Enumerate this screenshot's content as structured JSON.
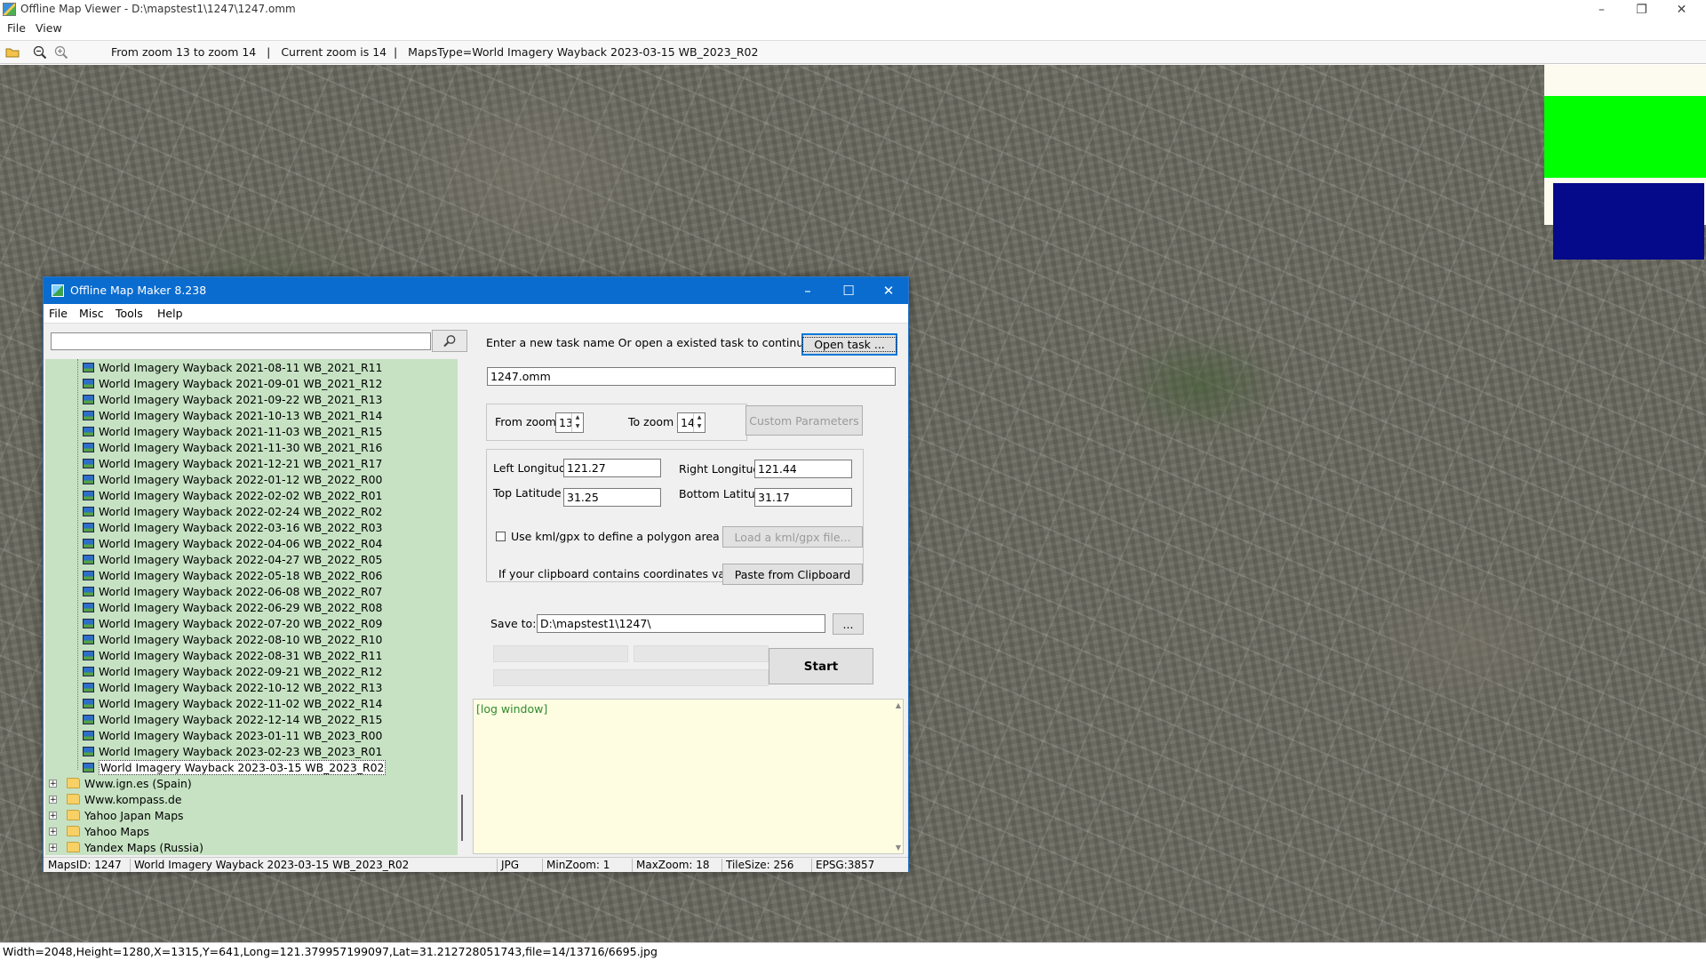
{
  "outer_window": {
    "title": "Offline Map Viewer - D:\\mapstest1\\1247\\1247.omm",
    "menu": [
      "File",
      "View"
    ],
    "toolbar_status": "From zoom 13 to zoom 14   |   Current zoom is 14  |   MapsType=World Imagery Wayback 2023-03-15 WB_2023_R02",
    "statusbar_text": "Width=2048,Height=1280,X=1315,Y=641,Long=121.379957199097,Lat=31.212728051743,file=14/13716/6695.jpg"
  },
  "overview": {
    "green_color": "#00ff00",
    "blue_color": "#050a8a"
  },
  "dialog": {
    "title": "Offline Map Maker 8.238",
    "menu": [
      "File",
      "Misc",
      "Tools",
      "Help"
    ],
    "search": {
      "value": "",
      "placeholder": ""
    },
    "tree_leaves": [
      "World Imagery Wayback 2021-08-11 WB_2021_R11",
      "World Imagery Wayback 2021-09-01 WB_2021_R12",
      "World Imagery Wayback 2021-09-22 WB_2021_R13",
      "World Imagery Wayback 2021-10-13 WB_2021_R14",
      "World Imagery Wayback 2021-11-03 WB_2021_R15",
      "World Imagery Wayback 2021-11-30 WB_2021_R16",
      "World Imagery Wayback 2021-12-21 WB_2021_R17",
      "World Imagery Wayback 2022-01-12 WB_2022_R00",
      "World Imagery Wayback 2022-02-02 WB_2022_R01",
      "World Imagery Wayback 2022-02-24 WB_2022_R02",
      "World Imagery Wayback 2022-03-16 WB_2022_R03",
      "World Imagery Wayback 2022-04-06 WB_2022_R04",
      "World Imagery Wayback 2022-04-27 WB_2022_R05",
      "World Imagery Wayback 2022-05-18 WB_2022_R06",
      "World Imagery Wayback 2022-06-08 WB_2022_R07",
      "World Imagery Wayback 2022-06-29 WB_2022_R08",
      "World Imagery Wayback 2022-07-20 WB_2022_R09",
      "World Imagery Wayback 2022-08-10 WB_2022_R10",
      "World Imagery Wayback 2022-08-31 WB_2022_R11",
      "World Imagery Wayback 2022-09-21 WB_2022_R12",
      "World Imagery Wayback 2022-10-12 WB_2022_R13",
      "World Imagery Wayback 2022-11-02 WB_2022_R14",
      "World Imagery Wayback 2022-12-14 WB_2022_R15",
      "World Imagery Wayback 2023-01-11 WB_2023_R00",
      "World Imagery Wayback 2023-02-23 WB_2023_R01",
      "World Imagery Wayback 2023-03-15 WB_2023_R02"
    ],
    "selected_leaf": "World Imagery Wayback 2023-03-15 WB_2023_R02",
    "tree_folders": [
      "Www.ign.es (Spain)",
      "Www.kompass.de",
      "Yahoo Japan Maps",
      "Yahoo Maps",
      "Yandex Maps (Russia)"
    ],
    "task_prompt": "Enter a new task name Or open a existed task to continue:",
    "open_task_label": "Open task ...",
    "task_name": "1247.omm",
    "from_zoom_label": "From zoom",
    "from_zoom_value": "13",
    "to_zoom_label": "To zoom",
    "to_zoom_value": "14",
    "custom_params_label": "Custom Parameters",
    "left_longitude_label": "Left Longitude",
    "left_longitude_value": "121.27",
    "right_longitude_label": "Right Longitude",
    "right_longitude_value": "121.44",
    "top_latitude_label": "Top Latitude",
    "top_latitude_value": "31.25",
    "bottom_latitude_label": "Bottom Latitude",
    "bottom_latitude_value": "31.17",
    "kml_checkbox_label": "Use kml/gpx to define a polygon area",
    "kml_checked": false,
    "load_kml_label": "Load a kml/gpx file...",
    "clipboard_prompt": "If your clipboard contains coordinates values:",
    "paste_label": "Paste from Clipboard",
    "save_to_label": "Save to:",
    "save_to_value": "D:\\mapstest1\\1247\\",
    "browse_label": "...",
    "start_label": "Start",
    "log_text": "[log window]",
    "status": {
      "maps_id": "MapsID: 1247",
      "maps_name": "World Imagery Wayback 2023-03-15 WB_2023_R02",
      "format": "JPG",
      "min_zoom": "MinZoom: 1",
      "max_zoom": "MaxZoom: 18",
      "tile_size": "TileSize: 256",
      "epsg": "EPSG:3857"
    }
  }
}
